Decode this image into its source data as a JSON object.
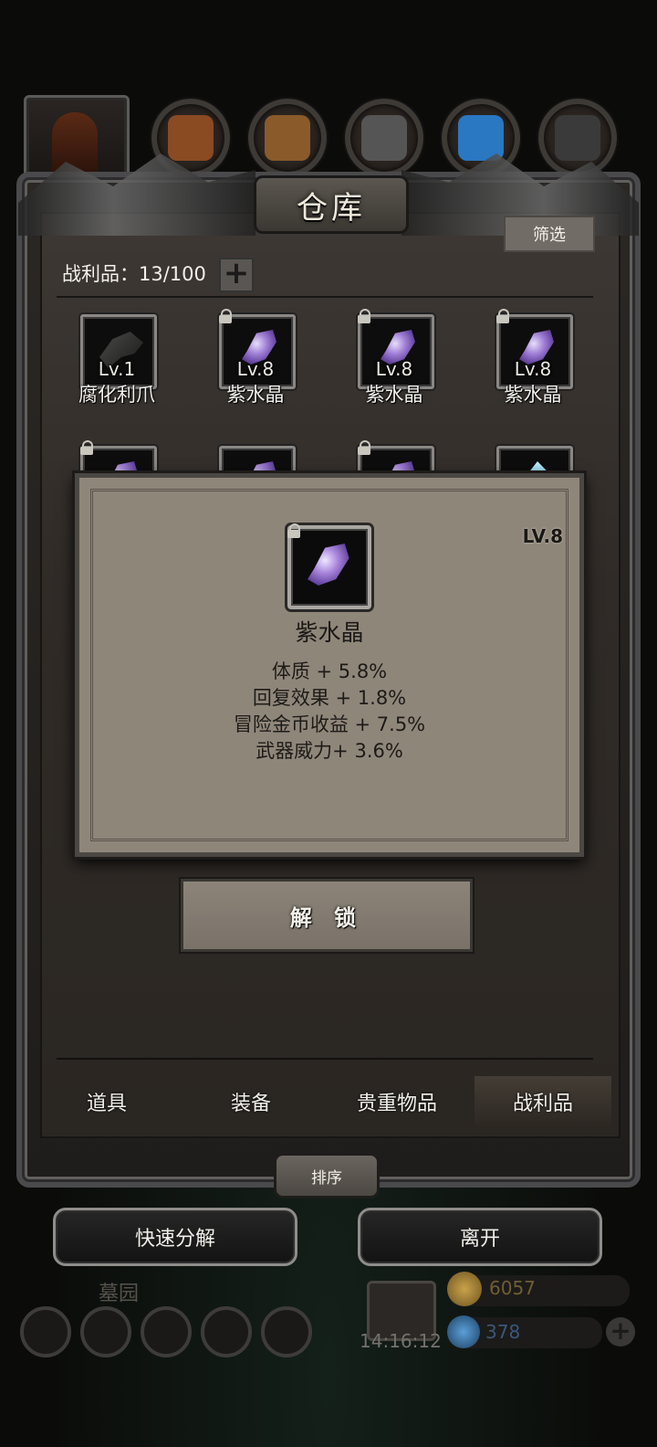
{
  "header": {
    "title": "仓库",
    "filter_label": "筛选"
  },
  "loot": {
    "count_label": "战利品：13/100",
    "add_label": "+"
  },
  "items_row1": [
    {
      "level": "Lv.1",
      "name": "腐化利爪",
      "kind": "claw",
      "locked": false
    },
    {
      "level": "Lv.8",
      "name": "紫水晶",
      "kind": "crystal",
      "locked": true
    },
    {
      "level": "Lv.8",
      "name": "紫水晶",
      "kind": "crystal",
      "locked": true
    },
    {
      "level": "Lv.8",
      "name": "紫水晶",
      "kind": "crystal",
      "locked": true
    }
  ],
  "popup": {
    "level": "LV.8",
    "name": "紫水晶",
    "stats": [
      "体质 + 5.8%",
      "回复效果 + 1.8%",
      "冒险金币收益 + 7.5%",
      "武器威力+ 3.6%"
    ],
    "unlock_label": "解 锁"
  },
  "tabs": [
    {
      "label": "道具",
      "active": false
    },
    {
      "label": "装备",
      "active": false
    },
    {
      "label": "贵重物品",
      "active": false
    },
    {
      "label": "战利品",
      "active": true
    }
  ],
  "sort_label": "排序",
  "actions": {
    "quick_decompose": "快速分解",
    "leave": "离开"
  },
  "hud": {
    "location": "墓园",
    "time": "14:16:12",
    "coins": "6057",
    "gems": "378",
    "add": "+"
  },
  "colors": {
    "panel": "#302b27",
    "popup": "#8f867a",
    "accent_crystal": "#9f7ed6"
  }
}
